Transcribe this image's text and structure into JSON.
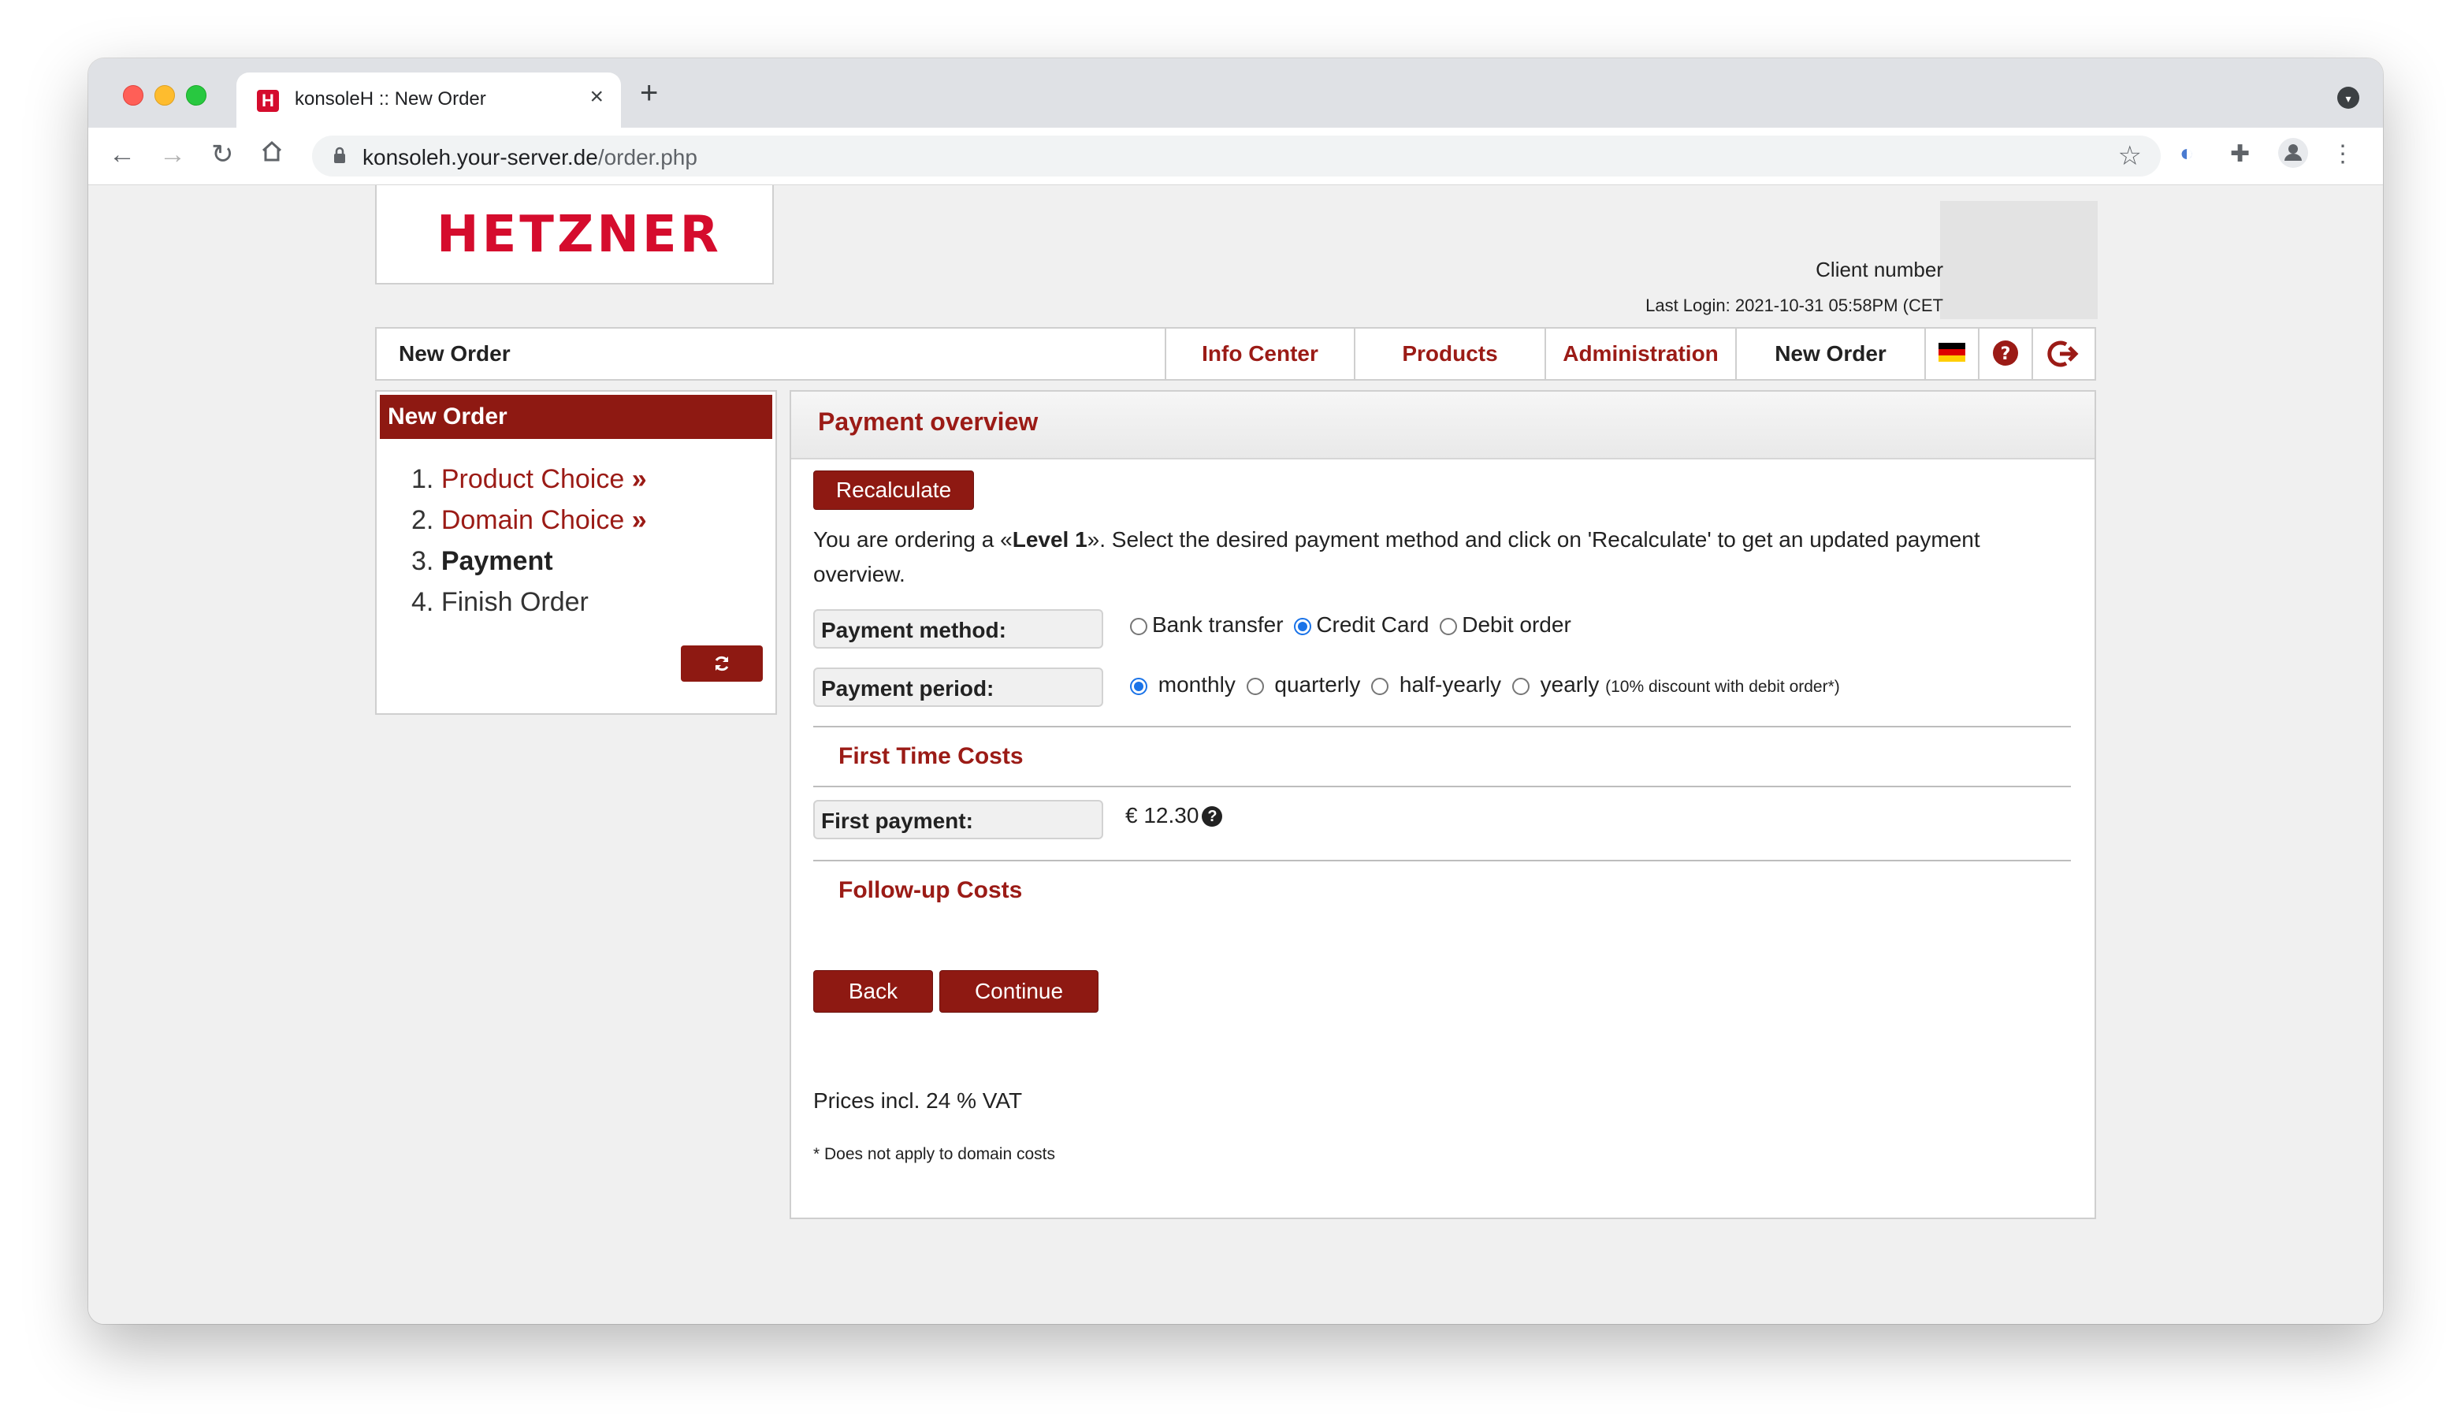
{
  "browser": {
    "tab_title": "konsoleH :: New Order",
    "tab_favicon": "H",
    "url_host": "konsoleh.your-server.de",
    "url_path": "/order.php"
  },
  "header": {
    "logo_text": "HETZNER",
    "client_number_label": "Client number",
    "last_login": "Last Login: 2021-10-31 05:58PM (CET"
  },
  "navbar": {
    "title": "New Order",
    "items": [
      "Info Center",
      "Products",
      "Administration",
      "New Order"
    ],
    "active_item": "New Order"
  },
  "sidebar": {
    "heading": "New Order",
    "steps": [
      {
        "num": "1.",
        "label": "Product Choice",
        "suffix": " »"
      },
      {
        "num": "2.",
        "label": "Domain Choice",
        "suffix": " »"
      },
      {
        "num": "3.",
        "label": "Payment"
      },
      {
        "num": "4.",
        "label": "Finish Order"
      }
    ],
    "refresh_icon": "refresh-icon"
  },
  "main": {
    "heading": "Payment overview",
    "recalculate_label": "Recalculate",
    "intro_pre": "You are ordering a «",
    "intro_product": "Level 1",
    "intro_post": "». Select the desired payment method and click on 'Recalculate' to get an updated payment overview.",
    "payment_method": {
      "label": "Payment method:",
      "options": [
        "Bank transfer",
        "Credit Card",
        "Debit order"
      ],
      "selected": "Credit Card"
    },
    "payment_period": {
      "label": "Payment period:",
      "options": [
        "monthly",
        "quarterly",
        "half-yearly",
        "yearly"
      ],
      "selected": "monthly",
      "note": "(10% discount with debit order*)"
    },
    "first_time_costs_title": "First Time Costs",
    "first_payment": {
      "label": "First payment:",
      "amount": "€ 12.30"
    },
    "follow_up_costs_title": "Follow-up Costs",
    "back_label": "Back",
    "continue_label": "Continue",
    "vat_note": "Prices incl. 24 % VAT",
    "footnote": "* Does not apply to domain costs"
  },
  "colors": {
    "brand_red": "#d50c2d",
    "accent_dark_red": "#8e1912",
    "link_red": "#9b1b16"
  }
}
